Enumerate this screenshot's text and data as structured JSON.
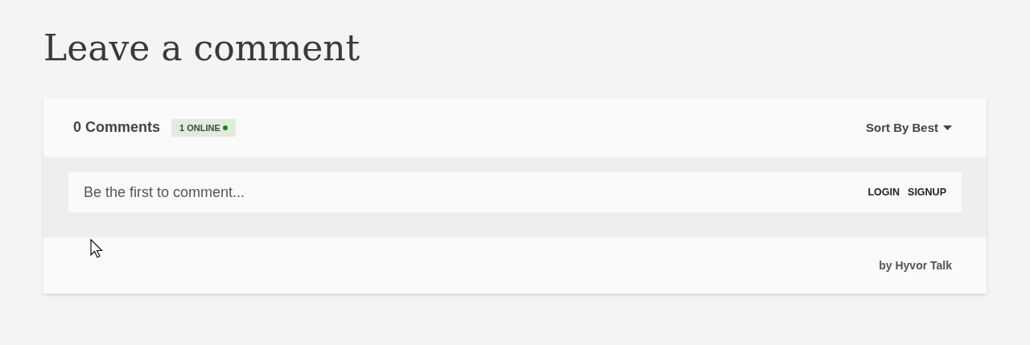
{
  "heading": "Leave a comment",
  "header": {
    "count": "0 Comments",
    "online": "1 ONLINE",
    "sort": "Sort By Best"
  },
  "editor": {
    "placeholder": "Be the first to comment...",
    "links": [
      "LOGIN",
      "SIGNUP"
    ]
  },
  "footer": {
    "credit": "by Hyvor Talk"
  }
}
